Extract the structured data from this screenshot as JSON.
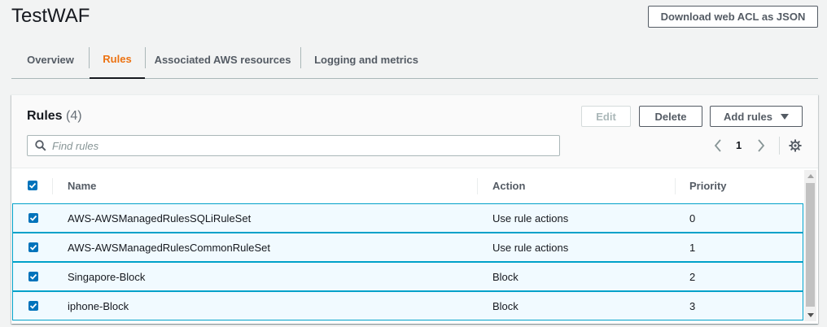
{
  "page": {
    "title": "TestWAF"
  },
  "header": {
    "download_label": "Download web ACL as JSON"
  },
  "tabs": [
    {
      "label": "Overview",
      "active": false
    },
    {
      "label": "Rules",
      "active": true
    },
    {
      "label": "Associated AWS resources",
      "active": false
    },
    {
      "label": "Logging and metrics",
      "active": false
    }
  ],
  "rules_panel": {
    "title": "Rules",
    "count": "(4)",
    "edit_label": "Edit",
    "delete_label": "Delete",
    "add_rules_label": "Add rules",
    "search_placeholder": "Find rules",
    "current_page": "1"
  },
  "table": {
    "columns": [
      "Name",
      "Action",
      "Priority"
    ],
    "rows": [
      {
        "name": "AWS-AWSManagedRulesSQLiRuleSet",
        "action": "Use rule actions",
        "priority": "0",
        "selected": true
      },
      {
        "name": "AWS-AWSManagedRulesCommonRuleSet",
        "action": "Use rule actions",
        "priority": "1",
        "selected": true
      },
      {
        "name": "Singapore-Block",
        "action": "Block",
        "priority": "2",
        "selected": true
      },
      {
        "name": "iphone-Block",
        "action": "Block",
        "priority": "3",
        "selected": true
      }
    ],
    "select_all": true
  },
  "icons": {
    "search": "search-icon",
    "prev": "chevron-left-icon",
    "next": "chevron-right-icon",
    "settings": "gear-icon",
    "dropdown": "caret-down-icon",
    "check": "check-icon"
  },
  "colors": {
    "active_tab": "#ec7211",
    "selected_row_bg": "#f1faff",
    "selected_row_border": "#00a1c9",
    "checkbox": "#0073bb"
  }
}
